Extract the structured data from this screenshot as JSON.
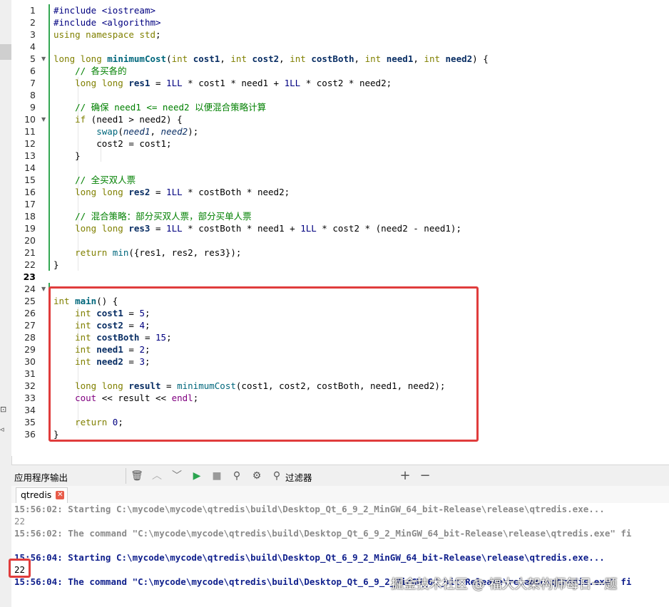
{
  "editor": {
    "line_numbers": [
      "1",
      "2",
      "3",
      "4",
      "5",
      "6",
      "7",
      "8",
      "9",
      "10",
      "11",
      "12",
      "13",
      "14",
      "15",
      "16",
      "17",
      "18",
      "19",
      "20",
      "21",
      "22",
      "23",
      "24",
      "25",
      "26",
      "27",
      "28",
      "29",
      "30",
      "31",
      "32",
      "33",
      "34",
      "35",
      "36"
    ],
    "current_line": "23",
    "code": {
      "l1_a": "#include ",
      "l1_b": "<iostream>",
      "l2_a": "#include ",
      "l2_b": "<algorithm>",
      "l3_a": "using",
      "l3_b": " namespace ",
      "l3_c": "std",
      "l3_d": ";",
      "l5_a": "long long ",
      "l5_b": "minimumCost",
      "l5_c": "(",
      "l5_d": "int ",
      "l5_e": "cost1",
      "l5_f": ", ",
      "l5_g": "int ",
      "l5_h": "cost2",
      "l5_i": ", ",
      "l5_j": "int ",
      "l5_k": "costBoth",
      "l5_l": ", ",
      "l5_m": "int ",
      "l5_n": "need1",
      "l5_o": ", ",
      "l5_p": "int ",
      "l5_q": "need2",
      "l5_r": ") {",
      "l6": "    // 各买各的",
      "l7_a": "    long long ",
      "l7_b": "res1",
      "l7_c": " = ",
      "l7_d": "1LL",
      "l7_e": " * cost1 * need1 + ",
      "l7_f": "1LL",
      "l7_g": " * cost2 * need2;",
      "l9": "    // 确保 need1 <= need2 以便混合策略计算",
      "l10_a": "    if",
      "l10_b": " (need1 > need2) {",
      "l11_a": "        swap",
      "l11_b": "(",
      "l11_c": "need1",
      "l11_d": ", ",
      "l11_e": "need2",
      "l11_f": ");",
      "l12": "        cost2 = cost1;",
      "l13": "    }",
      "l15": "    // 全买双人票",
      "l16_a": "    long long ",
      "l16_b": "res2",
      "l16_c": " = ",
      "l16_d": "1LL",
      "l16_e": " * costBoth * need2;",
      "l18": "    // 混合策略：部分买双人票，部分买单人票",
      "l19_a": "    long long ",
      "l19_b": "res3",
      "l19_c": " = ",
      "l19_d": "1LL",
      "l19_e": " * costBoth * need1 + ",
      "l19_f": "1LL",
      "l19_g": " * cost2 * (need2 - need1);",
      "l21_a": "    return ",
      "l21_b": "min",
      "l21_c": "({res1, res2, res3});",
      "l22": "}",
      "l24_a": "int ",
      "l24_b": "main",
      "l24_c": "() {",
      "l25_a": "    int ",
      "l25_b": "cost1",
      "l25_c": " = ",
      "l25_d": "5",
      "l25_e": ";",
      "l26_a": "    int ",
      "l26_b": "cost2",
      "l26_c": " = ",
      "l26_d": "4",
      "l26_e": ";",
      "l27_a": "    int ",
      "l27_b": "costBoth",
      "l27_c": " = ",
      "l27_d": "15",
      "l27_e": ";",
      "l28_a": "    int ",
      "l28_b": "need1",
      "l28_c": " = ",
      "l28_d": "2",
      "l28_e": ";",
      "l29_a": "    int ",
      "l29_b": "need2",
      "l29_c": " = ",
      "l29_d": "3",
      "l29_e": ";",
      "l31_a": "    long long ",
      "l31_b": "result",
      "l31_c": " = ",
      "l31_d": "minimumCost",
      "l31_e": "(cost1, cost2, costBoth, need1, need2);",
      "l32_a": "    ",
      "l32_b": "cout",
      "l32_c": " << result << ",
      "l32_d": "endl",
      "l32_e": ";",
      "l34_a": "    return ",
      "l34_b": "0",
      "l34_c": ";",
      "l35": "}"
    }
  },
  "output_pane": {
    "title": "应用程序输出",
    "filter_label": "过滤器",
    "icons": [
      "trash-icon",
      "arrow-up-icon",
      "arrow-down-icon",
      "run-icon",
      "stop-icon",
      "clean-icon",
      "gear-icon",
      "search-icon",
      "plus-icon",
      "minus-icon"
    ],
    "tab_label": "qtredis",
    "lines": [
      "15:56:02: Starting C:\\mycode\\mycode\\qtredis\\build\\Desktop_Qt_6_9_2_MinGW_64_bit-Release\\release\\qtredis.exe...",
      "22",
      "15:56:02: The command \"C:\\mycode\\mycode\\qtredis\\build\\Desktop_Qt_6_9_2_MinGW_64_bit-Release\\release\\qtredis.exe\" fi",
      "15:56:04: Starting C:\\mycode\\mycode\\qtredis\\build\\Desktop_Qt_6_9_2_MinGW_64_bit-Release\\release\\qtredis.exe...",
      "22",
      "15:56:04: The command \"C:\\mycode\\mycode\\qtredis\\build\\Desktop_Qt_6_9_2_MinGW_64_bit-Release\\release\\qtredis.exe\" fi"
    ]
  },
  "watermark": "掘金技术社区 @ 福大大架构师每日一题",
  "colors": {
    "highlight_box": "#e03c3c",
    "keyword": "#808000",
    "comment": "#008000",
    "function": "#00677c",
    "output_blue": "#0f1f8c"
  }
}
